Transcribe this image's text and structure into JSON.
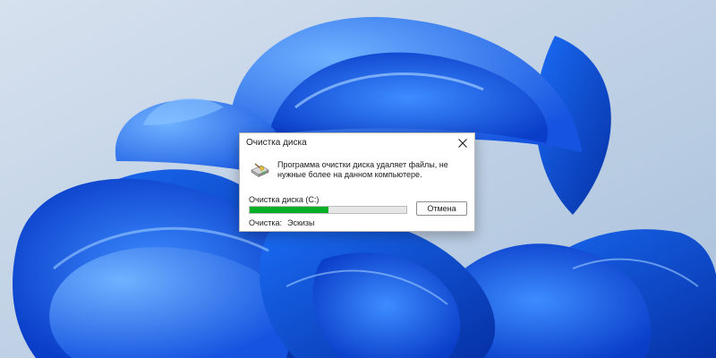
{
  "dialog": {
    "title": "Очистка диска",
    "message": "Программа очистки диска удаляет файлы, не нужные более на данном компьютере.",
    "drive_label": "Очистка диска  (C:)",
    "progress": 0.5,
    "progress_color": "#06b025",
    "cancel_label": "Отмена",
    "status_label": "Очистка:",
    "status_value": "Эскизы",
    "icons": {
      "close": "close-icon",
      "app": "disk-cleanup-icon"
    }
  },
  "desktop": {
    "wallpaper": "windows-11-bloom",
    "background_color": "#c6d5e6",
    "accent_color": "#1565e8"
  }
}
